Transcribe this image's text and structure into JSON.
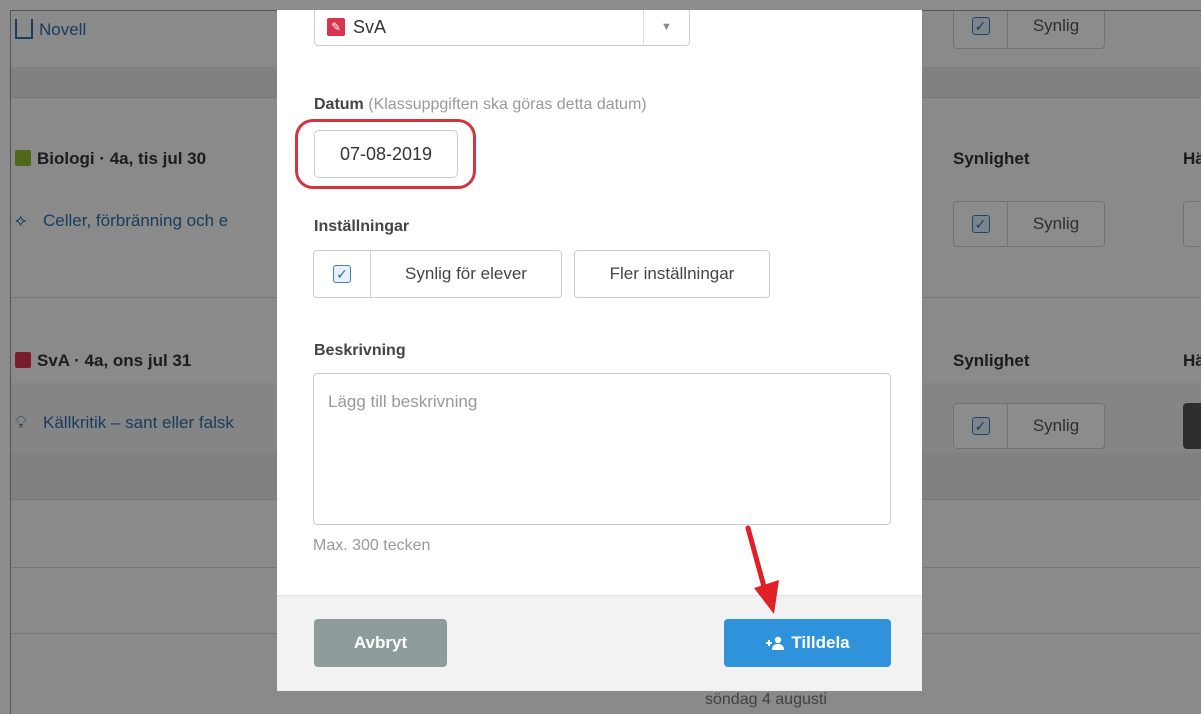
{
  "background": {
    "novel_link": "Novell",
    "visible_label": "Synlig",
    "visibility_header": "Synlighet",
    "cut_header": "Hä",
    "section_biology": {
      "title": "Biologi · 4a, tis jul 30",
      "color": "#8dbf2f",
      "task": "Celler, förbränning och e"
    },
    "section_sva": {
      "title": "SvA · 4a, ons jul 31",
      "color": "#d9334e",
      "task": "Källkritik – sant eller falsk"
    },
    "bottom_date": "söndag 4 augusti"
  },
  "modal": {
    "subject_select": {
      "value": "SvA",
      "icon": "pencil-icon",
      "color": "#d9334e"
    },
    "date_label": "Datum",
    "date_hint": "(Klassuppgiften ska göras detta datum)",
    "date_value": "07-08-2019",
    "settings_label": "Inställningar",
    "visible_for_students": "Synlig för elever",
    "visible_checked": true,
    "more_settings": "Fler inställningar",
    "description_label": "Beskrivning",
    "description_placeholder": "Lägg till beskrivning",
    "description_limit": "Max. 300 tecken",
    "cancel_label": "Avbryt",
    "assign_label": "Tilldela",
    "assign_icon": "add-user-icon"
  },
  "colors": {
    "accent": "#2f93dc",
    "annotation": "#d6333e",
    "cancel": "#8f9c9c"
  }
}
